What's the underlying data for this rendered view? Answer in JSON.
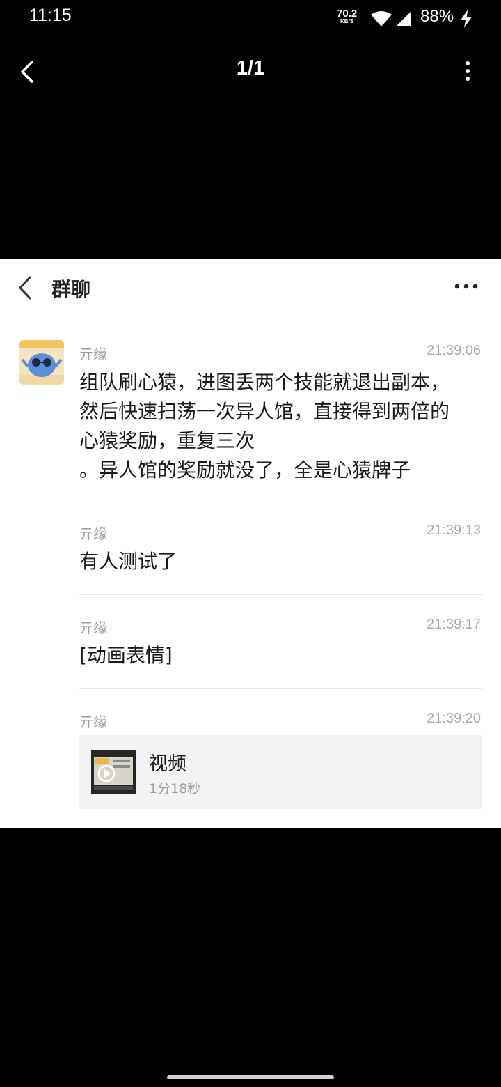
{
  "status_bar": {
    "time": "11:15",
    "net_speed": "70.2",
    "net_unit": "KB/S",
    "battery": "88%"
  },
  "viewer": {
    "page_indicator": "1/1"
  },
  "chat": {
    "title": "群聊",
    "messages": [
      {
        "sender": "亓缘",
        "time": "21:39:06",
        "lines": [
          "组队刷心猿，进图丢两个技能就退出副本，",
          "然后快速扫荡一次异人馆，直接得到两倍的",
          "心猿奖励，重复三次",
          "。异人馆的奖励就没了，全是心猿牌子"
        ]
      },
      {
        "sender": "亓缘",
        "time": "21:39:13",
        "text": "有人测试了"
      },
      {
        "sender": "亓缘",
        "time": "21:39:17",
        "text": "[动画表情]"
      },
      {
        "sender": "亓缘",
        "time": "21:39:20",
        "video": {
          "title": "视频",
          "duration": "1分18秒"
        }
      }
    ]
  },
  "icons": {
    "back": "chevron-left-icon",
    "more_vertical": "more-vertical-icon",
    "more_horizontal": "more-horizontal-icon",
    "wifi": "wifi-icon",
    "signal": "signal-icon",
    "charging": "charging-bolt-icon"
  }
}
